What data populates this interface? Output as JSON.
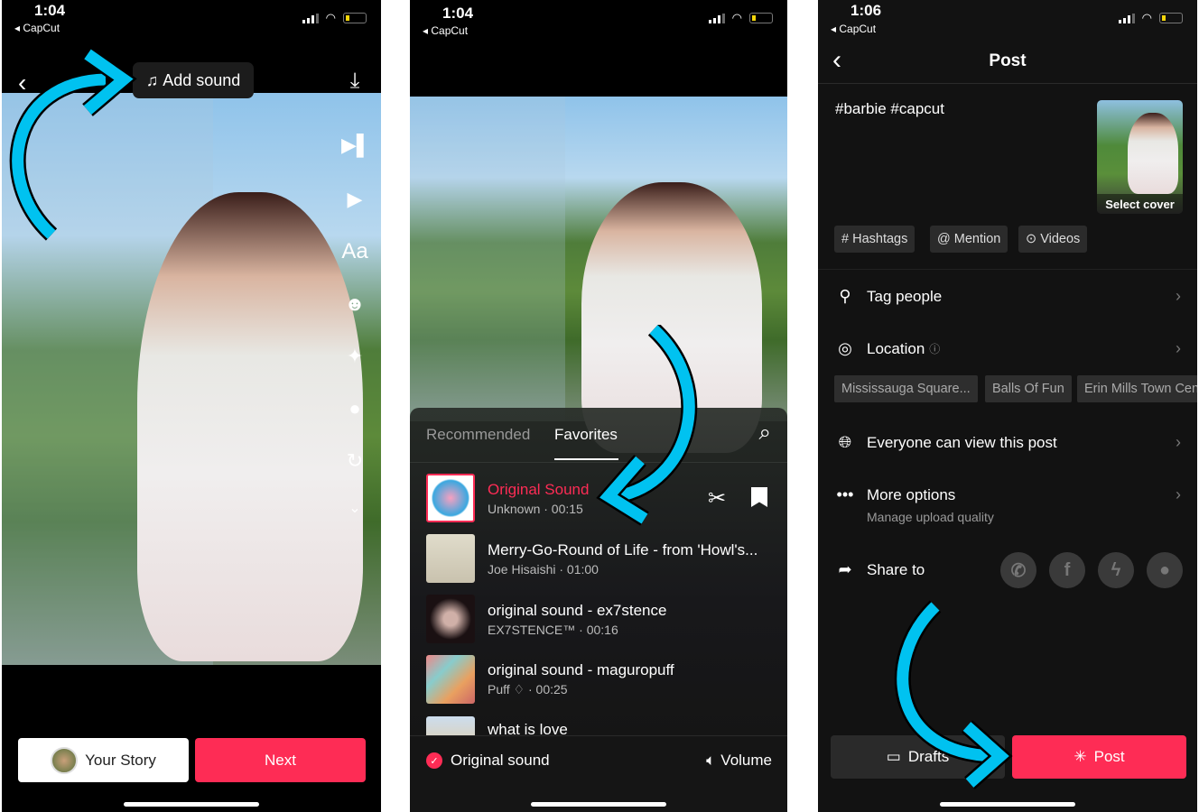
{
  "colors": {
    "accent": "#fe2c55",
    "arrow": "#00c2f0"
  },
  "panel1": {
    "status": {
      "time": "1:04",
      "back_app": "CapCut"
    },
    "add_sound": "Add sound",
    "side_text_tool": "Aa",
    "your_story": "Your Story",
    "next": "Next"
  },
  "panel2": {
    "status": {
      "time": "1:04",
      "back_app": "CapCut"
    },
    "tabs": [
      {
        "label": "Recommended",
        "active": false
      },
      {
        "label": "Favorites",
        "active": true
      }
    ],
    "tracks": [
      {
        "title": "Original Sound",
        "sub": "Unknown · 00:15",
        "selected": true
      },
      {
        "title": "Merry-Go-Round of Life - from 'Howl's...",
        "sub": "Joe Hisaishi · 01:00"
      },
      {
        "title": "original sound - ex7stence",
        "sub": "EX7STENCE™ · 00:16"
      },
      {
        "title": "original sound - maguropuff",
        "sub": "Puff ♢ · 00:25"
      },
      {
        "title": "what is love",
        "sub": ""
      }
    ],
    "original_sound": "Original sound",
    "volume": "Volume"
  },
  "panel3": {
    "status": {
      "time": "1:06",
      "back_app": "CapCut"
    },
    "title": "Post",
    "caption": "#barbie #capcut",
    "select_cover": "Select cover",
    "chips": [
      "# Hashtags",
      "@ Mention",
      "Videos"
    ],
    "tag_people": "Tag people",
    "location": "Location",
    "locations": [
      "Mississauga Square...",
      "Balls Of Fun",
      "Erin Mills Town Cen"
    ],
    "privacy": "Everyone can view this post",
    "more_options": "More options",
    "more_options_sub": "Manage upload quality",
    "share_to": "Share to",
    "drafts": "Drafts",
    "post": "Post"
  }
}
